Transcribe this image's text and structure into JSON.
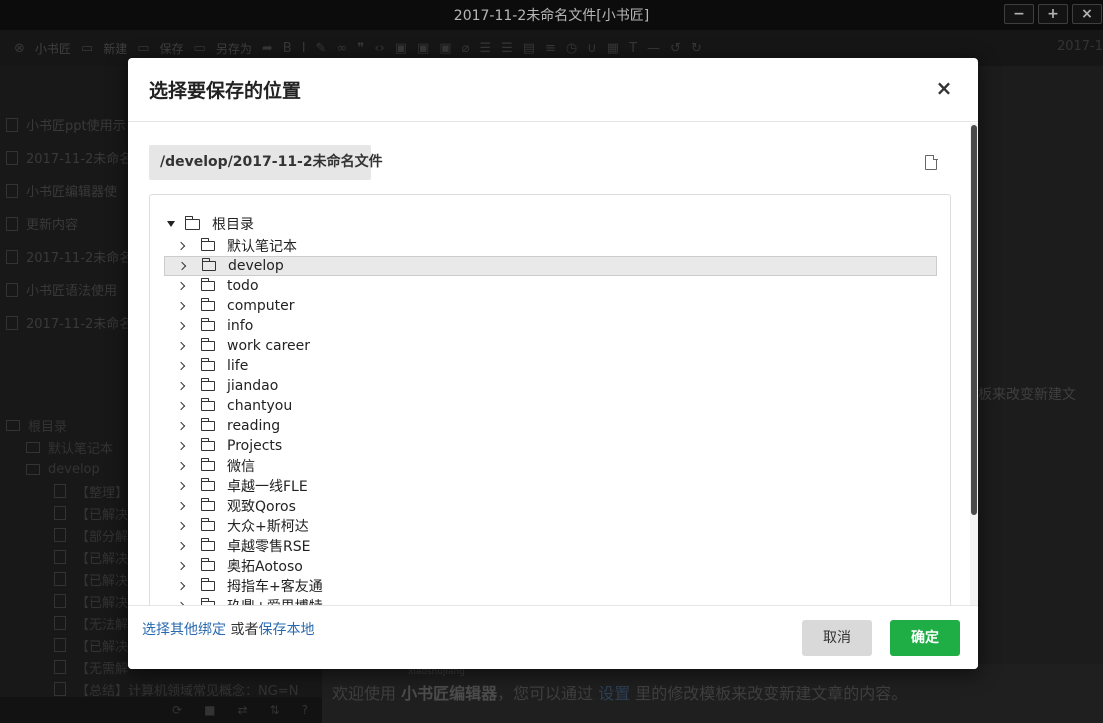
{
  "window": {
    "title": "2017-11-2未命名文件[小书匠]",
    "controls": [
      "−",
      "+",
      "×"
    ]
  },
  "toolbar": {
    "logo": "小书匠",
    "new_label": "新建",
    "save_label": "保存",
    "save_as_label": "另存为",
    "date": "2017-1"
  },
  "sidebar": {
    "docs": [
      "小书匠ppt使用示",
      "2017-11-2未命名",
      "小书匠编辑器使",
      "更新内容",
      "2017-11-2未命名",
      "小书匠语法使用",
      "2017-11-2未命名"
    ],
    "tree_root": "根目录",
    "tree_default": "默认笔记本",
    "tree_develop": "develop",
    "develop_docs": [
      "【整理】",
      "【已解决",
      "【部分解",
      "【已解决",
      "【已解决",
      "【已解决",
      "【无法解",
      "【已解决",
      "【无需解",
      "【总结】计算机领域常见概念：NG=N"
    ]
  },
  "main": {
    "hint": "板来改变新建文",
    "editor_author": "xiaoshujiang",
    "editor_pre": "欢迎使用 ",
    "editor_bold": "小书匠编辑器",
    "editor_mid": "，您可以通过 ",
    "editor_link": "设置",
    "editor_post": " 里的修改模板来改变新建文章的内容。"
  },
  "dialog": {
    "title": "选择要保存的位置",
    "close": "×",
    "path": "/develop/2017-11-2未命名文件",
    "root_label": "根目录",
    "folders": [
      "默认笔记本",
      "develop",
      "todo",
      "computer",
      "info",
      "work career",
      "life",
      "jiandao",
      "chantyou",
      "reading",
      "Projects",
      "微信",
      "卓越一线FLE",
      "观致Qoros",
      "大众+斯柯达",
      "卓越零售RSE",
      "奥拓Aotoso",
      "拇指车+客友通",
      "玖鼎+爱思博特"
    ],
    "selected_index": 1,
    "footer_link_bind": "选择其他绑定",
    "footer_or": " 或者",
    "footer_link_local": "保存本地",
    "cancel_label": "取消",
    "ok_label": "确定",
    "colors": {
      "ok": "#1fae46",
      "link": "#2a6ab0"
    }
  }
}
